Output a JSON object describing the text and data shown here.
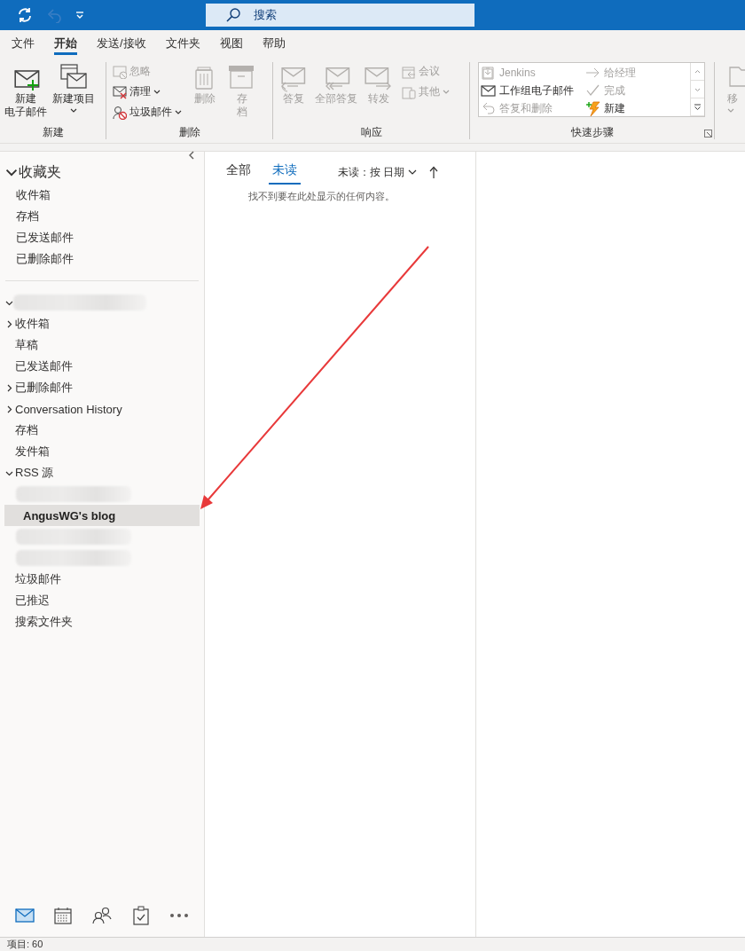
{
  "title_bar": {
    "quick_access": [
      {
        "disabled": false
      },
      {
        "disabled": true
      },
      {
        "disabled": false
      }
    ],
    "search": {
      "placeholder": "搜索"
    }
  },
  "menu_tabs": [
    {
      "label": "文件",
      "selected": false
    },
    {
      "label": "开始",
      "selected": true
    },
    {
      "label": "发送/接收",
      "selected": false
    },
    {
      "label": "文件夹",
      "selected": false
    },
    {
      "label": "视图",
      "selected": false
    },
    {
      "label": "帮助",
      "selected": false
    }
  ],
  "ribbon": {
    "groups": [
      {
        "label": "新建",
        "items": [
          {
            "kind": "large",
            "lines": [
              "新建",
              "电子邮件"
            ],
            "disabled": false
          },
          {
            "kind": "large",
            "lines": [
              "新建项目"
            ],
            "disabled": false,
            "dropdown": true
          }
        ]
      },
      {
        "label": "删除",
        "items": [
          {
            "kind": "small",
            "lines": [
              "忽略"
            ],
            "disabled": true
          },
          {
            "kind": "small",
            "lines": [
              "清理"
            ],
            "disabled": false,
            "dropdown": true
          },
          {
            "kind": "small",
            "lines": [
              "垃圾邮件"
            ],
            "disabled": false,
            "dropdown": true
          },
          {
            "kind": "large",
            "lines": [
              "删除"
            ],
            "disabled": true
          },
          {
            "kind": "large",
            "lines": [
              "存",
              "档"
            ],
            "disabled": true
          }
        ]
      },
      {
        "label": "响应",
        "items": [
          {
            "kind": "large",
            "lines": [
              "答复"
            ],
            "disabled": true
          },
          {
            "kind": "large",
            "lines": [
              "全部答复"
            ],
            "disabled": true
          },
          {
            "kind": "large",
            "lines": [
              "转发"
            ],
            "disabled": true
          },
          {
            "kind": "small",
            "lines": [
              "会议"
            ],
            "disabled": true
          },
          {
            "kind": "small",
            "lines": [
              "其他"
            ],
            "disabled": true,
            "dropdown": true
          }
        ]
      },
      {
        "label": "快速步骤",
        "launcher": true,
        "items": [
          {
            "kind": "gallery",
            "entries": [
              {
                "label": "Jenkins",
                "disabled": true
              },
              {
                "label": "给经理",
                "disabled": true
              },
              {
                "label": "工作组电子邮件",
                "disabled": false
              },
              {
                "label": "完成",
                "disabled": true
              },
              {
                "label": "答复和删除",
                "disabled": true
              },
              {
                "label": "新建",
                "disabled": false
              }
            ]
          }
        ]
      },
      {
        "items": [
          {
            "kind": "large",
            "lines": [
              "移"
            ],
            "disabled": true,
            "dropdown": true
          }
        ]
      }
    ]
  },
  "folder_pane": {
    "favorites": {
      "title": "收藏夹",
      "expanded": true,
      "folders": [
        {
          "name": "收件箱",
          "selected": false
        },
        {
          "name": "存档",
          "selected": false
        },
        {
          "name": "已发送邮件",
          "selected": false
        },
        {
          "name": "已删除邮件",
          "selected": false
        }
      ]
    },
    "account": {
      "expanded": true,
      "folders": [
        {
          "kind": "folder",
          "name": "收件箱",
          "expanded": false,
          "selected": false
        },
        {
          "kind": "folder",
          "name": "草稿",
          "selected": false
        },
        {
          "kind": "folder",
          "name": "已发送邮件",
          "selected": false
        },
        {
          "kind": "folder",
          "name": "已删除邮件",
          "expanded": false,
          "selected": false
        },
        {
          "kind": "folder",
          "name": "Conversation History",
          "expanded": false,
          "selected": false
        },
        {
          "kind": "folder",
          "name": "存档",
          "selected": false
        },
        {
          "kind": "folder",
          "name": "发件箱",
          "selected": false
        },
        {
          "kind": "folder",
          "name": "RSS 源",
          "expanded": true,
          "selected": false,
          "children": [
            {
              "kind": "redacted"
            },
            {
              "kind": "folder",
              "name": "AngusWG's blog",
              "selected": true
            }
          ]
        },
        {
          "kind": "redacted"
        },
        {
          "kind": "redacted"
        },
        {
          "kind": "folder",
          "name": "垃圾邮件",
          "selected": false
        },
        {
          "kind": "folder",
          "name": "已推迟",
          "selected": false
        },
        {
          "kind": "folder",
          "name": "搜索文件夹",
          "selected": false
        }
      ]
    },
    "nav": [
      {
        "selected": true
      },
      {
        "selected": false
      },
      {
        "selected": false
      },
      {
        "selected": false
      },
      {
        "selected": false
      }
    ]
  },
  "message_list": {
    "filters": [
      {
        "label": "全部",
        "selected": false
      },
      {
        "label": "未读",
        "selected": true
      }
    ],
    "sort": "未读：按 日期",
    "empty_text": "找不到要在此处显示的任何内容。"
  },
  "status_bar": {
    "text": "项目: 60"
  }
}
